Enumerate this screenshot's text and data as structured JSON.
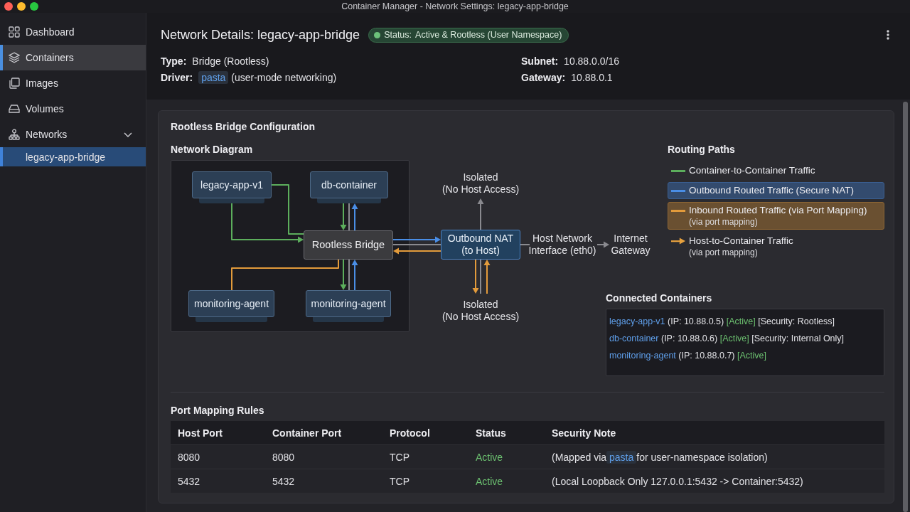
{
  "window": {
    "title": "Container Manager - Network Settings: legacy-app-bridge"
  },
  "sidebar": {
    "items": [
      {
        "label": "Dashboard",
        "selected": false,
        "hovered": false
      },
      {
        "label": "Containers",
        "selected": false,
        "hovered": true
      },
      {
        "label": "Images",
        "selected": false,
        "hovered": false
      },
      {
        "label": "Volumes",
        "selected": false,
        "hovered": false
      },
      {
        "label": "Networks",
        "selected": false,
        "hovered": false,
        "expanded": true,
        "children": [
          {
            "label": "legacy-app-bridge",
            "selected": true
          }
        ]
      }
    ]
  },
  "header": {
    "title": "Network Details: legacy-app-bridge",
    "status": {
      "label": "Status:",
      "value": "Active & Rootless (User Namespace)"
    },
    "fields": [
      {
        "label": "Type:",
        "value": [
          {
            "kind": "text",
            "text": "Bridge (Rootless)"
          }
        ]
      },
      {
        "label": "Subnet:",
        "value": [
          {
            "kind": "text",
            "text": "10.88.0.0/16"
          }
        ]
      },
      {
        "label": "Driver:",
        "value": [
          {
            "kind": "code",
            "text": "pasta"
          },
          {
            "kind": "text",
            "text": "(user-mode networking)"
          }
        ]
      },
      {
        "label": "Gateway:",
        "value": [
          {
            "kind": "text",
            "text": "10.88.0.1"
          }
        ]
      }
    ]
  },
  "config": {
    "title": "Rootless Bridge Configuration",
    "diagram": {
      "title": "Network Diagram",
      "nodes": [
        {
          "label": "legacy-app-v1",
          "kind": "container"
        },
        {
          "label": "db-container",
          "kind": "container"
        },
        {
          "label": "Isolated\n(No Host Access)",
          "kind": "label"
        },
        {
          "label": "Rootless Bridge",
          "kind": "bridge"
        },
        {
          "label": "Outbound NAT\n(to Host)",
          "kind": "nat"
        },
        {
          "label": "Host Network\nInterface (eth0)",
          "kind": "label"
        },
        {
          "label": "Internet\nGateway",
          "kind": "label"
        },
        {
          "label": "monitoring-agent",
          "kind": "container"
        },
        {
          "label": "monitoring-agent",
          "kind": "container"
        },
        {
          "label": "Isolated\n(No Host Access)",
          "kind": "label"
        }
      ]
    },
    "routing_paths": {
      "title": "Routing Paths",
      "items": [
        {
          "label": "Container-to-Container Traffic",
          "kind": "line",
          "color": "#5cae5c",
          "highlighted": false
        },
        {
          "label": "Outbound Routed Traffic (Secure NAT)",
          "kind": "line",
          "color": "#4a8ee6",
          "highlighted": true
        },
        {
          "label": "Inbound Routed Traffic (via Port Mapping)",
          "note": "(via port mapping)",
          "kind": "line",
          "color": "#e39b3b",
          "highlighted": true
        },
        {
          "label": "Host-to-Container Traffic",
          "note": "(via port mapping)",
          "kind": "arrow",
          "color": "#e8a23e",
          "highlighted": false
        }
      ]
    },
    "connected_containers": {
      "title": "Connected Containers",
      "items": [
        {
          "name": "legacy-app-v1",
          "ip": "(IP: 10.88.0.5)",
          "status": "[Active]",
          "security": "[Security: Rootless]"
        },
        {
          "name": "db-container",
          "ip": "(IP: 10.88.0.6)",
          "status": "[Active]",
          "security": "[Security: Internal Only]"
        },
        {
          "name": "monitoring-agent",
          "ip": "(IP: 10.88.0.7)",
          "status": "[Active]"
        }
      ]
    },
    "port_mapping": {
      "title": "Port Mapping Rules",
      "columns": [
        "Host Port",
        "Container Port",
        "Protocol",
        "Status",
        "Security Note"
      ],
      "rows": [
        {
          "host_port": "8080",
          "container_port": "8080",
          "protocol": "TCP",
          "status": "Active",
          "security_note": [
            {
              "kind": "text",
              "text": "(Mapped via"
            },
            {
              "kind": "code",
              "text": "pasta"
            },
            {
              "kind": "text",
              "text": "for user-namespace isolation)"
            }
          ]
        },
        {
          "host_port": "5432",
          "container_port": "5432",
          "protocol": "TCP",
          "status": "Active",
          "security_note": [
            {
              "kind": "text",
              "text": "(Local Loopback Only 127.0.0.1:5432 -> Container:5432)"
            }
          ]
        }
      ]
    }
  }
}
